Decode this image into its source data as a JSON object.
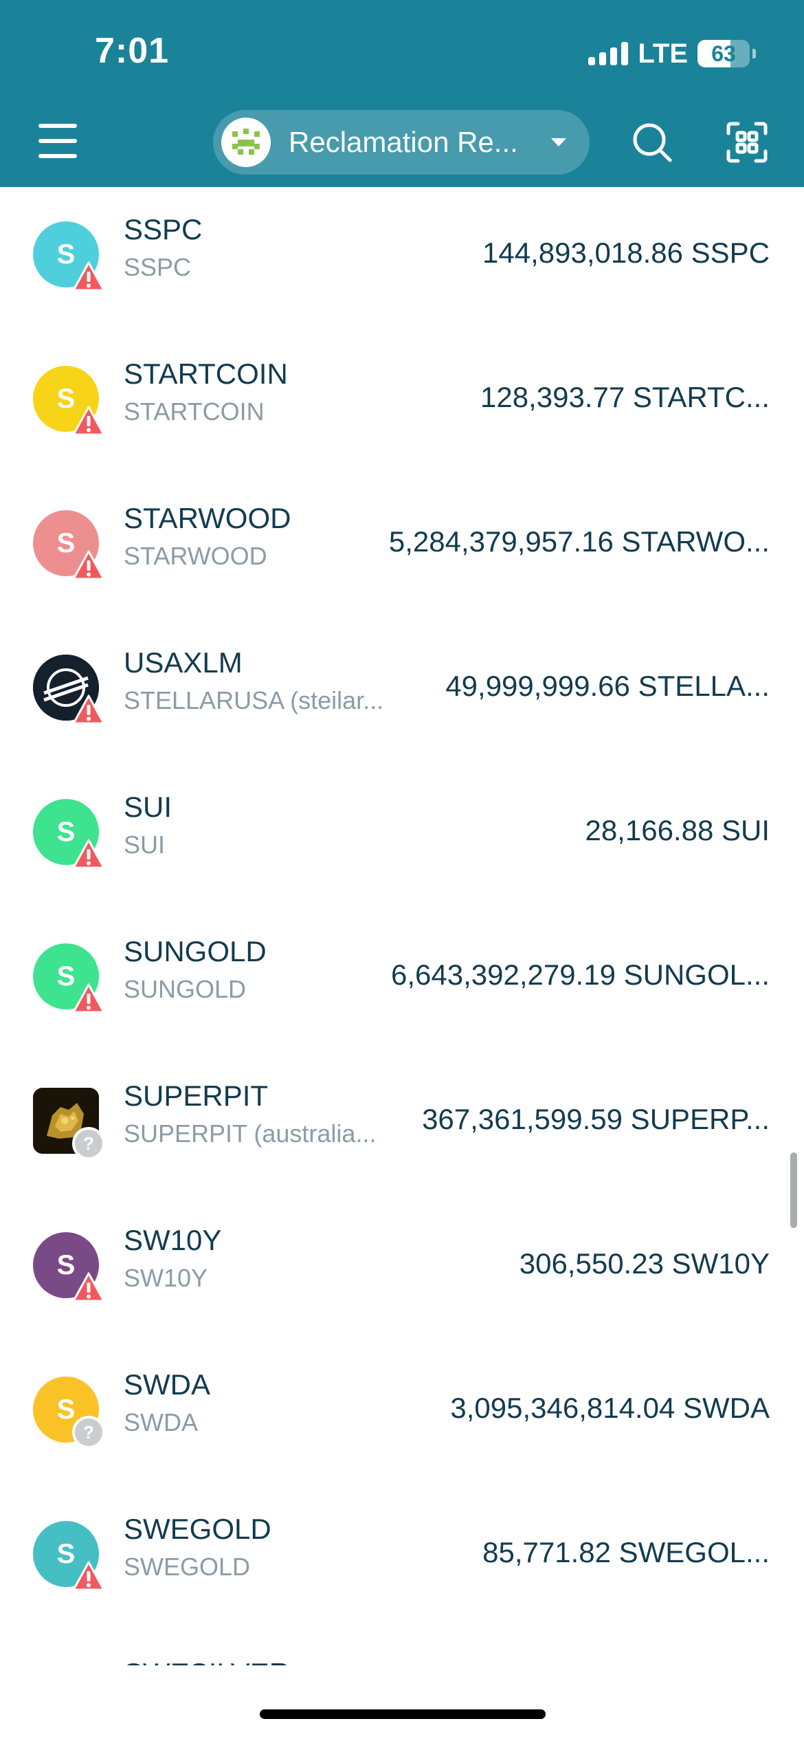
{
  "status_bar": {
    "time": "7:01",
    "network": "LTE",
    "battery": "63",
    "battery_level": 0.63
  },
  "header": {
    "account_name": "Reclamation Re..."
  },
  "colors": {
    "header_bg": "#1a8399",
    "warning": "#f05a5f",
    "unknown": "#c9cdd0"
  },
  "assets": [
    {
      "code": "SSPC",
      "name": "SSPC",
      "amount": "144,893,018.86 SSPC",
      "icon_letter": "S",
      "icon_color": "#4fcfdc",
      "badge": "warning-icon"
    },
    {
      "code": "STARTCOIN",
      "name": "STARTCOIN",
      "amount": "128,393.77 STARTC...",
      "icon_letter": "S",
      "icon_color": "#f7d418",
      "badge": "warning-icon"
    },
    {
      "code": "STARWOOD",
      "name": "STARWOOD",
      "amount": "5,284,379,957.16 STARWO...",
      "icon_letter": "S",
      "icon_color": "#ee8f8f",
      "badge": "warning-icon"
    },
    {
      "code": "USAXLM",
      "name": "STELLARUSA (steilar...",
      "amount": "49,999,999.66 STELLA...",
      "icon_letter": "",
      "icon_color": "#14202c",
      "icon": "stellar-logo-icon",
      "badge": "warning-icon"
    },
    {
      "code": "SUI",
      "name": "SUI",
      "amount": "28,166.88 SUI",
      "icon_letter": "S",
      "icon_color": "#3de38f",
      "badge": "warning-icon"
    },
    {
      "code": "SUNGOLD",
      "name": "SUNGOLD",
      "amount": "6,643,392,279.19 SUNGOL...",
      "icon_letter": "S",
      "icon_color": "#3de38f",
      "badge": "warning-icon"
    },
    {
      "code": "SUPERPIT",
      "name": "SUPERPIT (australia...",
      "amount": "367,361,599.59 SUPERP...",
      "icon_letter": "",
      "icon_color": "#1a1408",
      "icon": "gold-nugget-image",
      "badge": "question-icon"
    },
    {
      "code": "SW10Y",
      "name": "SW10Y",
      "amount": "306,550.23 SW10Y",
      "icon_letter": "S",
      "icon_color": "#7a4a86",
      "badge": "warning-icon"
    },
    {
      "code": "SWDA",
      "name": "SWDA",
      "amount": "3,095,346,814.04 SWDA",
      "icon_letter": "S",
      "icon_color": "#f9c227",
      "badge": "question-icon"
    },
    {
      "code": "SWEGOLD",
      "name": "SWEGOLD",
      "amount": "85,771.82 SWEGOL...",
      "icon_letter": "S",
      "icon_color": "#45bfc4",
      "badge": "warning-icon"
    },
    {
      "code": "SWESILVER",
      "name": "",
      "amount": "",
      "icon_letter": "",
      "icon_color": "#6fc9a6",
      "badge": ""
    }
  ]
}
